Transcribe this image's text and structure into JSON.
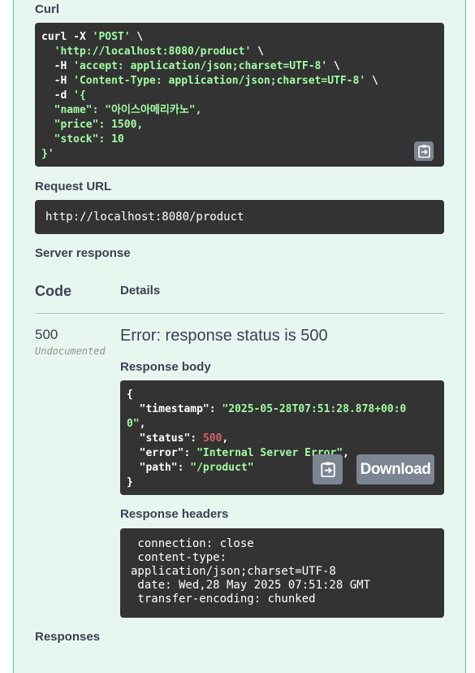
{
  "sections": {
    "curl_label": "Curl",
    "request_url_label": "Request URL",
    "server_response_label": "Server response",
    "responses_label": "Responses"
  },
  "curl": {
    "lines": [
      [
        {
          "t": "curl -X ",
          "c": "w"
        },
        {
          "t": "'POST'",
          "c": "s"
        },
        {
          "t": " \\",
          "c": "w"
        }
      ],
      [
        {
          "t": "  ",
          "c": "w"
        },
        {
          "t": "'http://localhost:8080/product'",
          "c": "s"
        },
        {
          "t": " \\",
          "c": "w"
        }
      ],
      [
        {
          "t": "  -H ",
          "c": "w"
        },
        {
          "t": "'accept: application/json;charset=UTF-8'",
          "c": "s"
        },
        {
          "t": " \\",
          "c": "w"
        }
      ],
      [
        {
          "t": "  -H ",
          "c": "w"
        },
        {
          "t": "'Content-Type: application/json;charset=UTF-8'",
          "c": "s"
        },
        {
          "t": " \\",
          "c": "w"
        }
      ],
      [
        {
          "t": "  -d ",
          "c": "w"
        },
        {
          "t": "'{",
          "c": "s"
        }
      ],
      [
        {
          "t": "  \"name\": \"아이스아메리카노\",",
          "c": "s"
        }
      ],
      [
        {
          "t": "  \"price\": 1500,",
          "c": "s"
        }
      ],
      [
        {
          "t": "  \"stock\": 10",
          "c": "s"
        }
      ],
      [
        {
          "t": "}'",
          "c": "s"
        }
      ]
    ]
  },
  "request_url": "http://localhost:8080/product",
  "response_table": {
    "code_header": "Code",
    "details_header": "Details",
    "status_code": "500",
    "status_note": "Undocumented",
    "error_title": "Error: response status is 500",
    "response_body_label": "Response body",
    "response_headers_label": "Response headers",
    "download_label": "Download"
  },
  "response_body": {
    "lines": [
      [
        {
          "t": "{",
          "c": "w"
        }
      ],
      [
        {
          "t": "  \"timestamp\"",
          "c": "w"
        },
        {
          "t": ": ",
          "c": "w"
        },
        {
          "t": "\"2025-05-28T07:51:28.878+00:0",
          "c": "s"
        }
      ],
      [
        {
          "t": "0\"",
          "c": "s"
        },
        {
          "t": ",",
          "c": "w"
        }
      ],
      [
        {
          "t": "  \"status\"",
          "c": "w"
        },
        {
          "t": ": ",
          "c": "w"
        },
        {
          "t": "500",
          "c": "n"
        },
        {
          "t": ",",
          "c": "w"
        }
      ],
      [
        {
          "t": "  \"error\"",
          "c": "w"
        },
        {
          "t": ": ",
          "c": "w"
        },
        {
          "t": "\"Internal Server Error\"",
          "c": "s"
        },
        {
          "t": ",",
          "c": "w"
        }
      ],
      [
        {
          "t": "  \"path\"",
          "c": "w"
        },
        {
          "t": ": ",
          "c": "w"
        },
        {
          "t": "\"/product\"",
          "c": "s"
        }
      ],
      [
        {
          "t": "}",
          "c": "w"
        }
      ]
    ]
  },
  "response_headers": {
    "lines": [
      " connection: close",
      " content-type:",
      "application/json;charset=UTF-8",
      " date: Wed,28 May 2025 07:51:28 GMT",
      " transfer-encoding: chunked"
    ]
  },
  "colors": {
    "panel_bg": "#e8f6f0",
    "panel_border": "#49cc90",
    "code_bg": "#333333",
    "string": "#a2fca2",
    "number": "#d36363",
    "button_bg": "#7d8492"
  },
  "icons": {
    "copy": "clipboard-icon"
  }
}
